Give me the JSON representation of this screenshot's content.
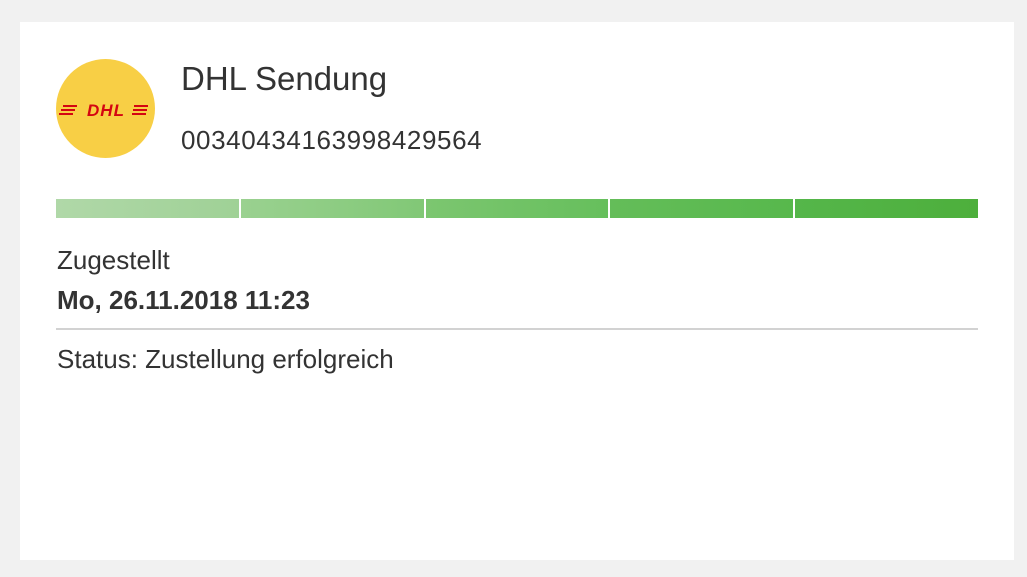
{
  "shipment": {
    "carrier_logo": "dhl-logo",
    "logo_text": "DHL",
    "title": "DHL Sendung",
    "tracking_number": "00340434163998429564"
  },
  "progress": {
    "segments_total": 5,
    "segments_completed": 5
  },
  "delivery": {
    "state_label": "Zugestellt",
    "datetime": "Mo, 26.11.2018 11:23",
    "status_text": "Status: Zustellung erfolgreich"
  },
  "colors": {
    "logo_background": "#f8cf45",
    "logo_text": "#d40511",
    "progress_start": "#b0d8a8",
    "progress_end": "#4daf3c"
  }
}
